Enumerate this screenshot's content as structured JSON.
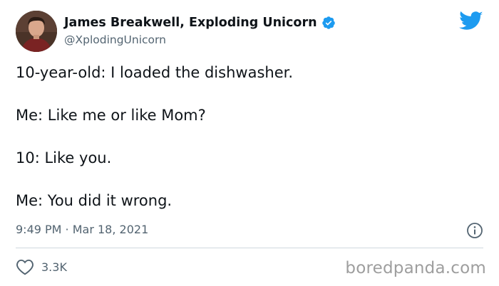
{
  "author": {
    "name": "James Breakwell, Exploding Unicorn",
    "handle": "@XplodingUnicorn",
    "verified": true
  },
  "tweet": {
    "lines": [
      "10-year-old: I loaded the dishwasher.",
      "Me: Like me or like Mom?",
      "10: Like you.",
      "Me: You did it wrong."
    ],
    "timestamp": "9:49 PM · Mar 18, 2021"
  },
  "engagement": {
    "likes": "3.3K"
  },
  "watermark": "boredpanda.com",
  "colors": {
    "twitter_blue": "#1d9bf0",
    "text": "#0f1419",
    "secondary_text": "#536471",
    "divider": "#cfd9de"
  },
  "icons": [
    "avatar",
    "verified-badge-icon",
    "twitter-bird-icon",
    "info-icon",
    "heart-icon"
  ]
}
